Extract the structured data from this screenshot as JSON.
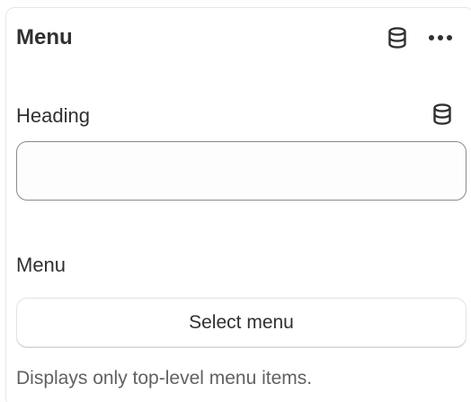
{
  "panel": {
    "title": "Menu",
    "header_icons": [
      "dynamic-source-icon",
      "more-horizontal-icon"
    ]
  },
  "heading_field": {
    "label": "Heading",
    "value": "",
    "icon": "dynamic-source-icon"
  },
  "menu_field": {
    "label": "Menu",
    "button_label": "Select menu",
    "help_text": "Displays only top-level menu items."
  },
  "colors": {
    "text": "#303030",
    "muted_text": "#616161",
    "input_border": "#8a8a8a",
    "panel_border": "#e6e6e6"
  }
}
